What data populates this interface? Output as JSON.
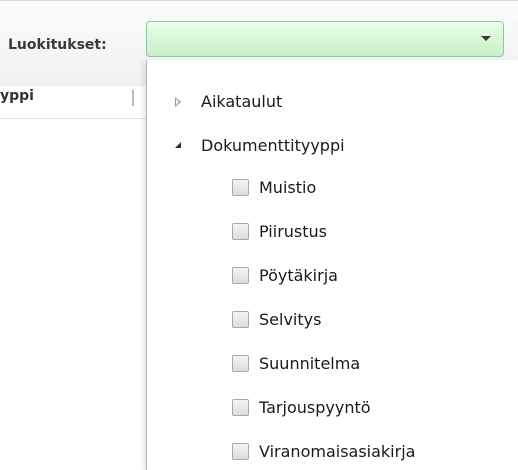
{
  "filter": {
    "label": "Luokitukset:",
    "selected_value": ""
  },
  "grid": {
    "header_partial": "yppi"
  },
  "tree": {
    "nodes": [
      {
        "label": "Aikataulut",
        "expanded": false
      },
      {
        "label": "Dokumenttityyppi",
        "expanded": true,
        "children": [
          {
            "label": "Muistio",
            "checked": false
          },
          {
            "label": "Piirustus",
            "checked": false
          },
          {
            "label": "Pöytäkirja",
            "checked": false
          },
          {
            "label": "Selvitys",
            "checked": false
          },
          {
            "label": "Suunnitelma",
            "checked": false
          },
          {
            "label": "Tarjouspyyntö",
            "checked": false
          },
          {
            "label": "Viranomaisasiakirja",
            "checked": false
          }
        ]
      }
    ]
  },
  "colors": {
    "combo_fill": "#c8f0c8",
    "combo_border": "#8cc79a"
  },
  "icons": {
    "collapsed": "triangle-right-outline",
    "expanded": "triangle-down-filled",
    "dropdown": "chevron-down"
  }
}
